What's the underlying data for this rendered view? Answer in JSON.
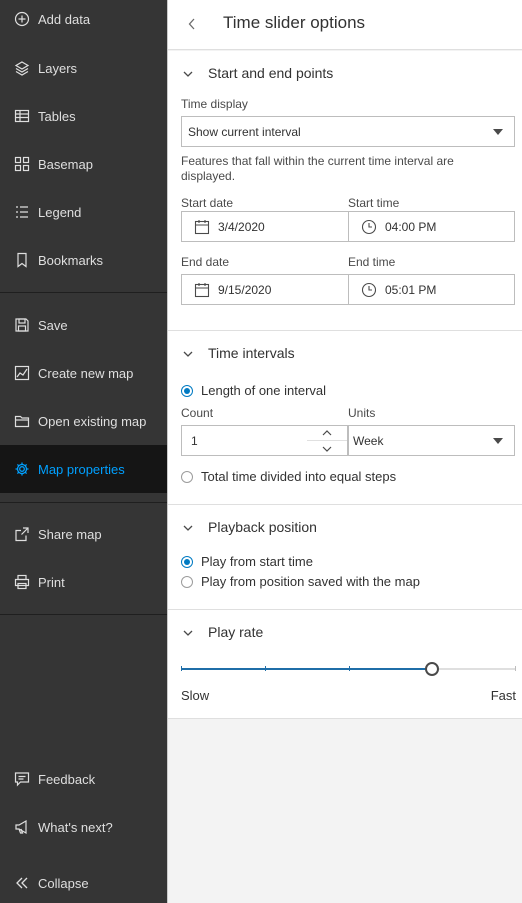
{
  "sidebar": {
    "items": [
      {
        "label": "Add data",
        "icon": "add-data-icon"
      },
      {
        "label": "Layers",
        "icon": "layers-icon"
      },
      {
        "label": "Tables",
        "icon": "table-icon"
      },
      {
        "label": "Basemap",
        "icon": "basemap-icon"
      },
      {
        "label": "Legend",
        "icon": "legend-icon"
      },
      {
        "label": "Bookmarks",
        "icon": "bookmark-icon"
      },
      {
        "label": "Save",
        "icon": "save-icon"
      },
      {
        "label": "Create new map",
        "icon": "new-map-icon"
      },
      {
        "label": "Open existing map",
        "icon": "folder-icon"
      },
      {
        "label": "Map properties",
        "icon": "gear-icon",
        "active": true
      },
      {
        "label": "Share map",
        "icon": "share-icon"
      },
      {
        "label": "Print",
        "icon": "print-icon"
      },
      {
        "label": "Feedback",
        "icon": "feedback-icon"
      },
      {
        "label": "What's next?",
        "icon": "megaphone-icon"
      },
      {
        "label": "Collapse",
        "icon": "chevrons-left-icon"
      }
    ],
    "accent_color": "#00a0ff"
  },
  "panel": {
    "title": "Time slider options",
    "start_end": {
      "title": "Start and end points",
      "time_display_label": "Time display",
      "time_display_value": "Show current interval",
      "help": "Features that fall within the current time interval are displayed.",
      "start_date_label": "Start date",
      "start_date": "3/4/2020",
      "start_time_label": "Start time",
      "start_time": "04:00 PM",
      "end_date_label": "End date",
      "end_date": "9/15/2020",
      "end_time_label": "End time",
      "end_time": "05:01 PM"
    },
    "intervals": {
      "title": "Time intervals",
      "option_length": "Length of one interval",
      "count_label": "Count",
      "count_value": "1",
      "units_label": "Units",
      "units_value": "Week",
      "option_total": "Total time divided into equal steps",
      "selected": "length"
    },
    "playback": {
      "title": "Playback position",
      "option_start": "Play from start time",
      "option_saved": "Play from position saved with the map",
      "selected": "start"
    },
    "play_rate": {
      "title": "Play rate",
      "slow": "Slow",
      "fast": "Fast",
      "value_fraction": 0.75,
      "steps": 4
    }
  }
}
